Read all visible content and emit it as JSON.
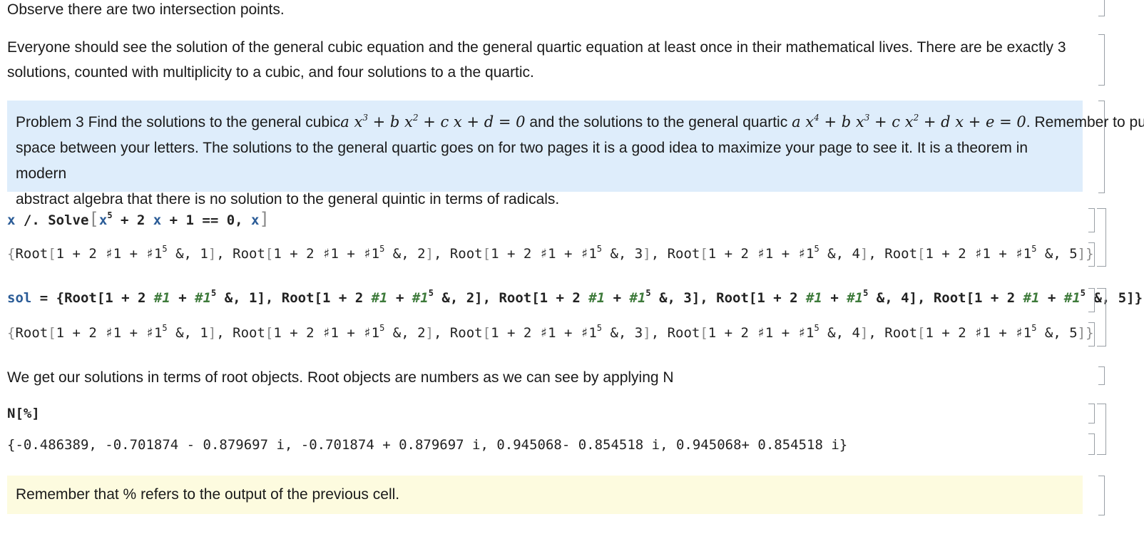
{
  "cells": {
    "t1": "Observe there are two intersection points.",
    "t2_line1": "Everyone should see the solution of the general cubic equation and the general quartic equation at least once in their mathematical lives. There are be exactly 3",
    "t2_line2": "solutions, counted with multiplicity  to a cubic, and four solutions to  a the quartic.",
    "problem": {
      "label": "Problem 3",
      "text_a": "Find the solutions to the general cubic",
      "text_b": "and the solutions to the general quartic",
      "text_c": ". Remember to put a",
      "line2": "space between your letters. The solutions to the general quartic goes on for two pages it is a good idea to maximize your page to see it. It is a theorem in modern",
      "line3": "abstract algebra that there is no solution to the general quintic in terms of radicals."
    },
    "in1": {
      "x": "x",
      "op": " /. Solve",
      "tail": " + 1 == 0, "
    },
    "sol_name": "sol",
    "t3": "We get our solutions in terms of root objects. Root objects are numbers as we can see by applying N",
    "in3": "N[%]",
    "out3": "{-0.486389, -0.701874 - 0.879697 i, -0.701874 + 0.879697 i, 0.945068- 0.854518 i, 0.945068+ 0.854518 i}",
    "remember": "Remember that % refers to the output of the previous cell."
  }
}
